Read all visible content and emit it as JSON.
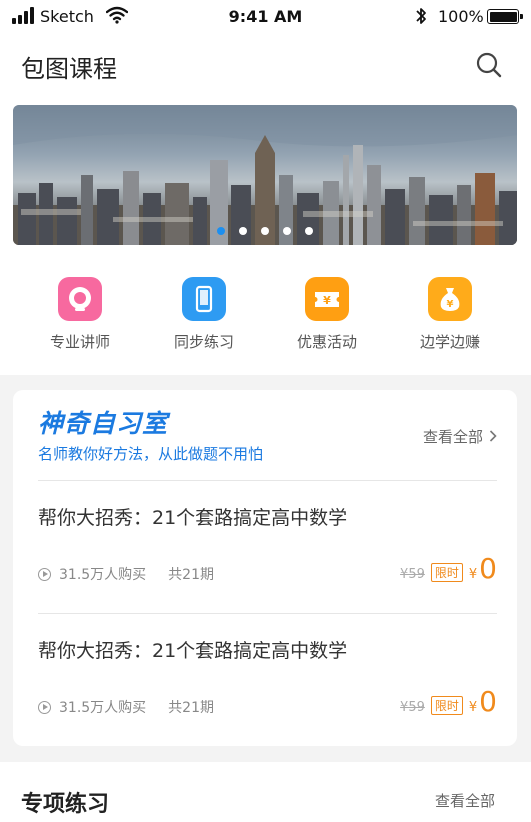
{
  "status": {
    "carrier": "Sketch",
    "time": "9:41 AM",
    "battery": "100%"
  },
  "header": {
    "title": "包图课程"
  },
  "banner": {
    "page_count": 5,
    "active_index": 0
  },
  "quick_nav": [
    {
      "label": "专业讲师",
      "icon": "lecturer-icon",
      "color": "#f7699f"
    },
    {
      "label": "同步练习",
      "icon": "phone-icon",
      "color": "#2e9bf2"
    },
    {
      "label": "优惠活动",
      "icon": "coupon-icon",
      "color": "#ff9f12"
    },
    {
      "label": "边学边赚",
      "icon": "money-bag-icon",
      "color": "#ffab1a"
    }
  ],
  "study_room": {
    "title": "神奇自习室",
    "subtitle": "名师教你好方法，从此做题不用怕",
    "view_all": "查看全部",
    "courses": [
      {
        "title": "帮你大招秀：21个套路搞定高中数学",
        "buyers": "31.5万人购买",
        "periods": "共21期",
        "old_price": "¥59",
        "tag": "限时",
        "currency": "¥",
        "price": "0"
      },
      {
        "title": "帮你大招秀：21个套路搞定高中数学",
        "buyers": "31.5万人购买",
        "periods": "共21期",
        "old_price": "¥59",
        "tag": "限时",
        "currency": "¥",
        "price": "0"
      }
    ]
  },
  "special_practice": {
    "title": "专项练习",
    "view_all": "查看全部"
  },
  "colors": {
    "accent_blue": "#1b7ae0",
    "price_orange": "#f08a1c"
  }
}
